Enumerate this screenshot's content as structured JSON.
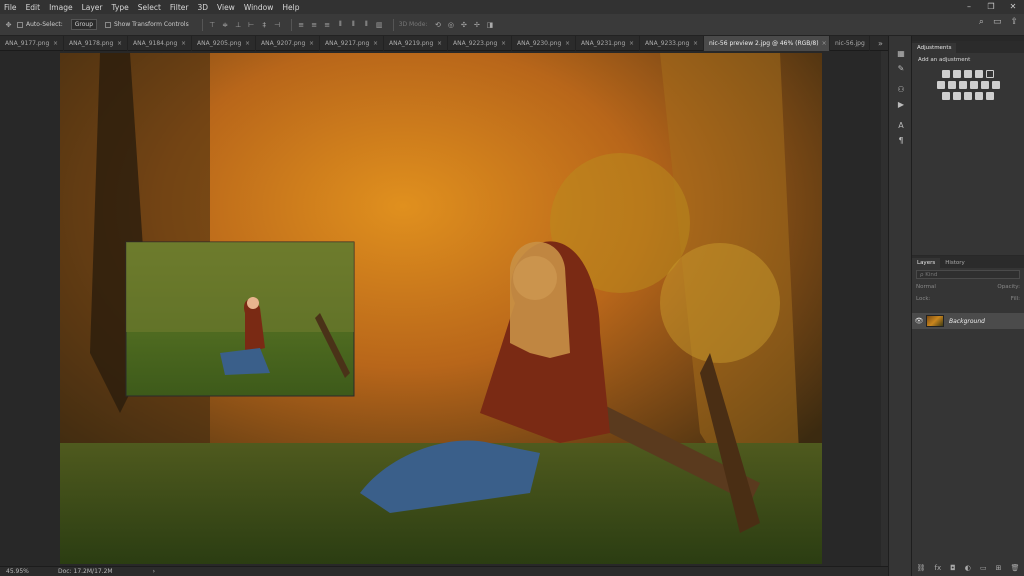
{
  "menu": [
    "File",
    "Edit",
    "Image",
    "Layer",
    "Type",
    "Select",
    "Filter",
    "3D",
    "View",
    "Window",
    "Help"
  ],
  "window_controls": [
    "–",
    "❐",
    "✕"
  ],
  "options": {
    "auto_select": "Auto-Select:",
    "group": "Group",
    "show_transform": "Show Transform Controls",
    "mode_3d": "3D Mode:"
  },
  "tabs": [
    {
      "label": "ANA_9177.png"
    },
    {
      "label": "ANA_9178.png"
    },
    {
      "label": "ANA_9184.png"
    },
    {
      "label": "ANA_9205.png"
    },
    {
      "label": "ANA_9207.png"
    },
    {
      "label": "ANA_9217.png"
    },
    {
      "label": "ANA_9219.png"
    },
    {
      "label": "ANA_9223.png"
    },
    {
      "label": "ANA_9230.png"
    },
    {
      "label": "ANA_9231.png"
    },
    {
      "label": "ANA_9233.png"
    },
    {
      "label": "nic-56 preview 2.jpg @ 46% (RGB/8)"
    },
    {
      "label": "nic-56.jpg"
    }
  ],
  "tab_close": "×",
  "tab_overflow": "»",
  "status": {
    "zoom": "45.95%",
    "doc": "Doc: 17.2M/17.2M",
    "arrow": "›"
  },
  "adjustments": {
    "tab": "Adjustments",
    "header": "Add an adjustment"
  },
  "layers_panel": {
    "tabs": [
      "Layers",
      "History"
    ],
    "kind": "ρ Kind",
    "blend": "Normal",
    "opacity": "Opacity:",
    "lock": "Lock:",
    "fill": "Fill:",
    "layer_name": "Background"
  },
  "colors": {
    "accent": "#4b4b4b",
    "bg": "#282828",
    "panel": "#353535"
  }
}
